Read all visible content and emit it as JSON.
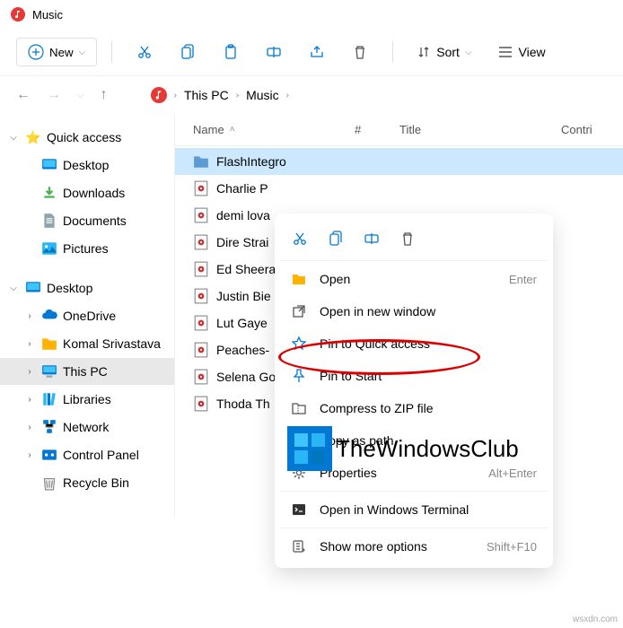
{
  "window": {
    "title": "Music"
  },
  "toolbar": {
    "new_label": "New",
    "sort_label": "Sort",
    "view_label": "View"
  },
  "breadcrumb": {
    "items": [
      "This PC",
      "Music"
    ]
  },
  "sidebar": {
    "quick_access": {
      "label": "Quick access",
      "items": [
        {
          "label": "Desktop",
          "icon": "desktop"
        },
        {
          "label": "Downloads",
          "icon": "downloads"
        },
        {
          "label": "Documents",
          "icon": "documents"
        },
        {
          "label": "Pictures",
          "icon": "pictures"
        }
      ]
    },
    "desktop": {
      "label": "Desktop",
      "items": [
        {
          "label": "OneDrive",
          "icon": "cloud"
        },
        {
          "label": "Komal Srivastava",
          "icon": "user"
        },
        {
          "label": "This PC",
          "icon": "pc",
          "selected": true
        },
        {
          "label": "Libraries",
          "icon": "libraries"
        },
        {
          "label": "Network",
          "icon": "network"
        },
        {
          "label": "Control Panel",
          "icon": "control"
        },
        {
          "label": "Recycle Bin",
          "icon": "recycle"
        }
      ]
    }
  },
  "columns": {
    "name": "Name",
    "num": "#",
    "title": "Title",
    "contrib": "Contri"
  },
  "files": [
    {
      "name": "FlashIntegro",
      "type": "folder",
      "selected": true
    },
    {
      "name": "Charlie P",
      "type": "audio"
    },
    {
      "name": "demi lova",
      "type": "audio"
    },
    {
      "name": "Dire Strai",
      "type": "audio"
    },
    {
      "name": "Ed Sheera",
      "type": "audio"
    },
    {
      "name": "Justin Bie",
      "type": "audio"
    },
    {
      "name": "Lut Gaye",
      "type": "audio"
    },
    {
      "name": "Peaches-",
      "type": "audio"
    },
    {
      "name": "Selena Go",
      "type": "audio"
    },
    {
      "name": "Thoda Th",
      "type": "audio"
    }
  ],
  "context_menu": {
    "items": [
      {
        "label": "Open",
        "shortcut": "Enter",
        "icon": "folder"
      },
      {
        "label": "Open in new window",
        "icon": "new-window"
      },
      {
        "label": "Pin to Quick access",
        "icon": "star"
      },
      {
        "label": "Pin to Start",
        "icon": "pin"
      },
      {
        "label": "Compress to ZIP file",
        "icon": "zip"
      },
      {
        "label": "Copy as path",
        "icon": "copy-path"
      },
      {
        "label": "Properties",
        "shortcut": "Alt+Enter",
        "icon": "properties"
      },
      {
        "label": "Open in Windows Terminal",
        "icon": "terminal"
      },
      {
        "label": "Show more options",
        "shortcut": "Shift+F10",
        "icon": "more"
      }
    ]
  },
  "watermark": {
    "text": "TheWindowsClub"
  },
  "corner": {
    "text": "wsxdn.com"
  }
}
